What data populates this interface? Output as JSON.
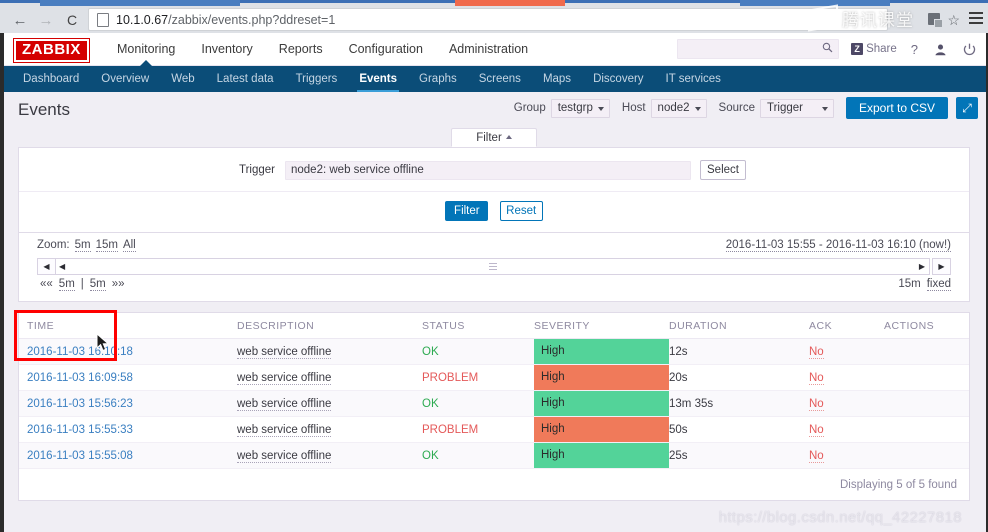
{
  "browser": {
    "url_host": "10.1.0.67",
    "url_path": "/zabbix/events.php?ddreset=1",
    "back_glyph": "←",
    "forward_glyph": "→",
    "reload_glyph": "C",
    "star_glyph": "☆",
    "watermark_text": "腾讯课堂"
  },
  "header": {
    "logo_text": "ZABBIX",
    "menu": [
      {
        "label": "Monitoring",
        "selected": true
      },
      {
        "label": "Inventory",
        "selected": false
      },
      {
        "label": "Reports",
        "selected": false
      },
      {
        "label": "Configuration",
        "selected": false
      },
      {
        "label": "Administration",
        "selected": false
      }
    ],
    "search_placeholder": "",
    "search_value": "",
    "share_label": "Share",
    "share_badge": "Z",
    "help_glyph": "?",
    "user_glyph": "●",
    "signout_glyph": "⏻"
  },
  "subnav": [
    {
      "label": "Dashboard",
      "selected": false
    },
    {
      "label": "Overview",
      "selected": false
    },
    {
      "label": "Web",
      "selected": false
    },
    {
      "label": "Latest data",
      "selected": false
    },
    {
      "label": "Triggers",
      "selected": false
    },
    {
      "label": "Events",
      "selected": true
    },
    {
      "label": "Graphs",
      "selected": false
    },
    {
      "label": "Screens",
      "selected": false
    },
    {
      "label": "Maps",
      "selected": false
    },
    {
      "label": "Discovery",
      "selected": false
    },
    {
      "label": "IT services",
      "selected": false
    }
  ],
  "page": {
    "title": "Events",
    "controls": {
      "group_label": "Group",
      "group_value": "testgrp",
      "host_label": "Host",
      "host_value": "node2",
      "source_label": "Source",
      "source_value": "Trigger",
      "export_label": "Export to CSV",
      "kiosk_glyph": "⤢"
    }
  },
  "filter": {
    "tab_label": "Filter",
    "trigger_label": "Trigger",
    "trigger_value": "node2: web service offline",
    "trigger_placeholder": "",
    "select_button": "Select",
    "apply_button": "Filter",
    "reset_button": "Reset"
  },
  "timeselector": {
    "zoom_label": "Zoom:",
    "zoom_options": [
      "5m",
      "15m",
      "All"
    ],
    "range_text": "2016-11-03 15:55 - 2016-11-03 16:10 (now!)",
    "nav_first": "««",
    "nav_prev": "5m",
    "nav_divider": "|",
    "nav_next": "5m",
    "nav_last": "»»",
    "period_label": "15m",
    "fixed_label": "fixed",
    "arrow_left": "◀",
    "arrow_right": "▶"
  },
  "events": {
    "columns": [
      "TIME",
      "DESCRIPTION",
      "STATUS",
      "SEVERITY",
      "DURATION",
      "ACK",
      "ACTIONS"
    ],
    "rows": [
      {
        "time": "2016-11-03 16:10:18",
        "description": "web service offline",
        "status": "OK",
        "severity": "High",
        "duration": "12s",
        "ack": "No",
        "actions": ""
      },
      {
        "time": "2016-11-03 16:09:58",
        "description": "web service offline",
        "status": "PROBLEM",
        "severity": "High",
        "duration": "20s",
        "ack": "No",
        "actions": ""
      },
      {
        "time": "2016-11-03 15:56:23",
        "description": "web service offline",
        "status": "OK",
        "severity": "High",
        "duration": "13m 35s",
        "ack": "No",
        "actions": ""
      },
      {
        "time": "2016-11-03 15:55:33",
        "description": "web service offline",
        "status": "PROBLEM",
        "severity": "High",
        "duration": "50s",
        "ack": "No",
        "actions": ""
      },
      {
        "time": "2016-11-03 15:55:08",
        "description": "web service offline",
        "status": "OK",
        "severity": "High",
        "duration": "25s",
        "ack": "No",
        "actions": ""
      }
    ],
    "footer": "Displaying 5 of 5 found"
  },
  "overlay": {
    "watermark": "https://blog.csdn.net/qq_42227818"
  },
  "colors": {
    "brand_red": "#d40000",
    "nav_blue": "#0b4d78",
    "accent_blue": "#0275b8",
    "severity_ok": "#53d399",
    "severity_problem": "#f07a5a",
    "status_ok": "#2eab52",
    "status_problem": "#e45959",
    "annotation_red": "#ff0000"
  }
}
